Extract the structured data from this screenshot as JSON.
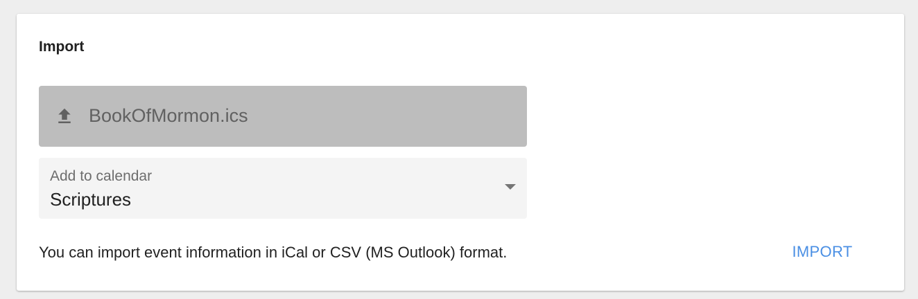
{
  "card": {
    "title": "Import"
  },
  "file_picker": {
    "icon": "upload-icon",
    "file_name": "BookOfMormon.ics",
    "background": "#bdbdbd"
  },
  "calendar_select": {
    "label": "Add to calendar",
    "value": "Scriptures",
    "icon": "dropdown-arrow-icon"
  },
  "help_text": "You can import event information in iCal or CSV (MS Outlook) format.",
  "actions": {
    "import_label": "IMPORT",
    "accent_color": "#4a8fe4"
  }
}
